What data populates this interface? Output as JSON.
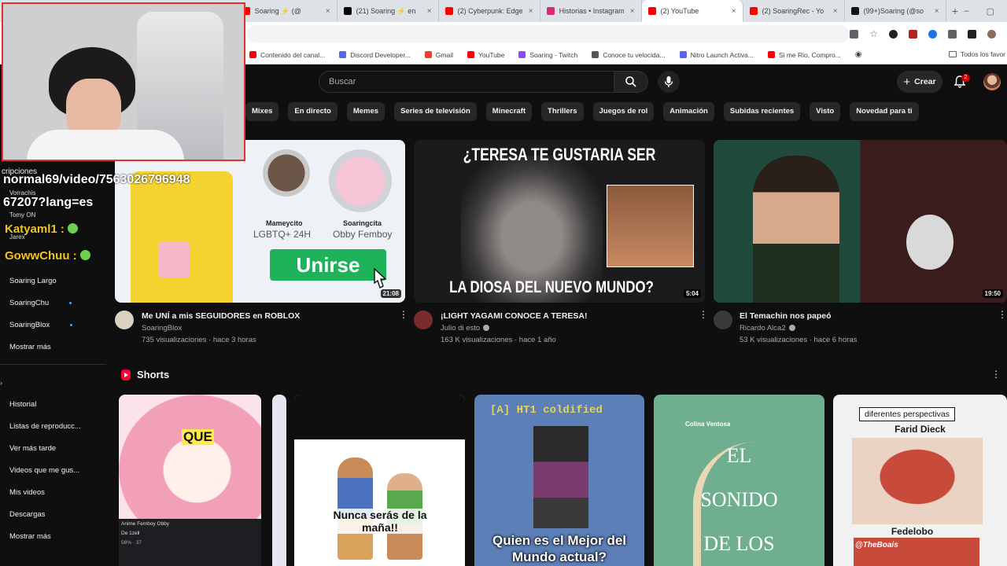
{
  "tabs": [
    {
      "label": "Soaring ⚡ (@",
      "color": "#ff0000",
      "active": false
    },
    {
      "label": "(21) Soaring ⚡ en",
      "color": "#000000",
      "active": false
    },
    {
      "label": "(2) Cyberpunk: Edge",
      "color": "#ff0000",
      "active": false
    },
    {
      "label": "Historias • Instagram",
      "color": "#d62976",
      "active": false
    },
    {
      "label": "(2) YouTube",
      "color": "#ff0000",
      "active": true
    },
    {
      "label": "(2) SoaringRec - Yo",
      "color": "#ff0000",
      "active": false
    },
    {
      "label": "(99+)Soaring (@so",
      "color": "#111111",
      "active": false
    }
  ],
  "bookmarks": [
    {
      "label": "Contenido del canal...",
      "color": "#ff0000"
    },
    {
      "label": "Discord Developer...",
      "color": "#5865f2"
    },
    {
      "label": "Gmail",
      "color": "#ea4335"
    },
    {
      "label": "YouTube",
      "color": "#ff0000"
    },
    {
      "label": "Soaring - Twitch",
      "color": "#9146ff"
    },
    {
      "label": "Conoce tu velocida...",
      "color": "#555555"
    },
    {
      "label": "Nitro Launch Activa...",
      "color": "#5865f2"
    },
    {
      "label": "Si me Rio, Compro...",
      "color": "#ff0000"
    }
  ],
  "bookmarks_right": "Todos los favor",
  "header": {
    "search_placeholder": "Buscar",
    "create_label": "Crear",
    "notif_count": "2"
  },
  "chips": [
    "Mixes",
    "En directo",
    "Memes",
    "Series de televisión",
    "Minecraft",
    "Thrillers",
    "Juegos de rol",
    "Animación",
    "Subidas recientes",
    "Visto",
    "Novedad para ti"
  ],
  "sidebar": {
    "subs_partial": "cripciones",
    "channels": [
      {
        "label": "Soaring Largo",
        "dot": false
      },
      {
        "label": "SoaringChu",
        "dot": true
      },
      {
        "label": "SoaringBlox",
        "dot": true
      }
    ],
    "show_more_1": "Mostrar más",
    "you_items": [
      "Historial",
      "Listas de reproducc...",
      "Ver más tarde",
      "Videos que me gus...",
      "Mis videos",
      "Descargas"
    ],
    "show_more_2": "Mostrar más"
  },
  "videos": [
    {
      "title": "Me UNÍ a mis SEGUIDORES en ROBLOX",
      "channel": "SoaringBlox",
      "verified": false,
      "meta": "735 visualizaciones · hace 3 horas",
      "duration": "21:08",
      "thumb": {
        "name_left": "Mameycito",
        "sub_left": "LGBTQ+ 24H",
        "name_right": "Soaringcita",
        "sub_right": "Obby Femboy",
        "button": "Unirse"
      }
    },
    {
      "title": "¡LIGHT YAGAMI CONOCE A TERESA!",
      "channel": "Julio di esto",
      "verified": true,
      "meta": "163 K visualizaciones · hace 1 año",
      "duration": "5:04",
      "thumb": {
        "top_text": "¿TERESA TE GUSTARIA SER",
        "bottom_text": "LA DIOSA DEL NUEVO MUNDO?"
      }
    },
    {
      "title": "El Temachin nos papeó",
      "channel": "Ricardo Alca2",
      "verified": true,
      "meta": "53 K visualizaciones · hace 6 horas",
      "duration": "19:50"
    }
  ],
  "shorts": {
    "heading": "Shorts",
    "items": [
      {
        "overlay": "QUE",
        "caption": "Anime Femboy Obby",
        "caption2": "De 1zell",
        "stats": "58% · 37"
      },
      {
        "overlay": "Nunca serás de la maña!!"
      },
      {
        "top": "[A] HT1 coldified",
        "overlay": "Quien es el Mejor del Mundo actual?"
      },
      {
        "top": "Colina Ventosa",
        "overlay_lines": [
          "EL",
          "SONIDO",
          "DE LOS"
        ]
      },
      {
        "top": "diferentes perspectivas",
        "name1": "Farid Dieck",
        "name2": "Fedelobo",
        "tag": "@TheBoais"
      }
    ]
  },
  "overlay": {
    "url_line1": "normal69/video/7563026796948",
    "url_line2": "67207?lang=es",
    "chat": [
      {
        "user": "Vorrachis",
        "small": true
      },
      {
        "user": "Tomy ON",
        "small": true
      },
      {
        "user": "Katyaml1 :",
        "color": "#f5c518",
        "size": 15
      },
      {
        "user": "Jarex",
        "small": true
      },
      {
        "user": "GowwChuu :",
        "color": "#f5c518",
        "size": 15
      }
    ]
  },
  "colors": {
    "bg": "#0f0f0f",
    "chip": "#272727",
    "accent": "#ff0033",
    "blue": "#3ea6ff"
  }
}
